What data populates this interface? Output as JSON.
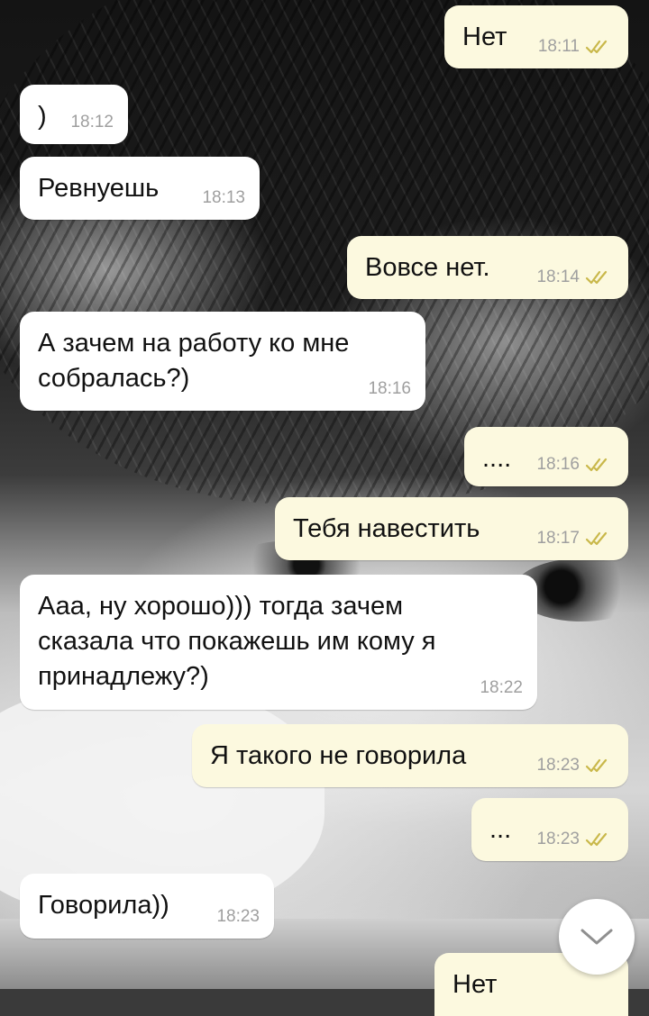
{
  "chat": {
    "messages": [
      {
        "direction": "out",
        "text": "Нет",
        "time": "18:11",
        "read": true
      },
      {
        "direction": "in",
        "text": ")",
        "time": "18:12"
      },
      {
        "direction": "in",
        "text": "Ревнуешь",
        "time": "18:13"
      },
      {
        "direction": "out",
        "text": "Вовсе нет.",
        "time": "18:14",
        "read": true
      },
      {
        "direction": "in",
        "text": "А зачем на работу ко мне\nсобралась?)",
        "time": "18:16"
      },
      {
        "direction": "out",
        "text": "....",
        "time": "18:16",
        "read": true
      },
      {
        "direction": "out",
        "text": "Тебя навестить",
        "time": "18:17",
        "read": true
      },
      {
        "direction": "in",
        "text": "Ааа, ну хорошо))) тогда зачем\nсказала что покажешь им кому я\nпринадлежу?)",
        "time": "18:22"
      },
      {
        "direction": "out",
        "text": "Я такого не говорила",
        "time": "18:23",
        "read": true
      },
      {
        "direction": "out",
        "text": "...",
        "time": "18:23",
        "read": true
      },
      {
        "direction": "in",
        "text": "Говорила))",
        "time": "18:23"
      },
      {
        "direction": "out",
        "text": "Нет",
        "time": "",
        "read": false
      }
    ]
  },
  "colors": {
    "incoming_bubble": "#ffffff",
    "outgoing_bubble": "#fcf9df",
    "read_ticks": "#c9b84a",
    "time_text": "#9f9f9f"
  },
  "icons": {
    "read_receipt": "double-check-icon",
    "scroll_down": "chevron-down-icon"
  }
}
